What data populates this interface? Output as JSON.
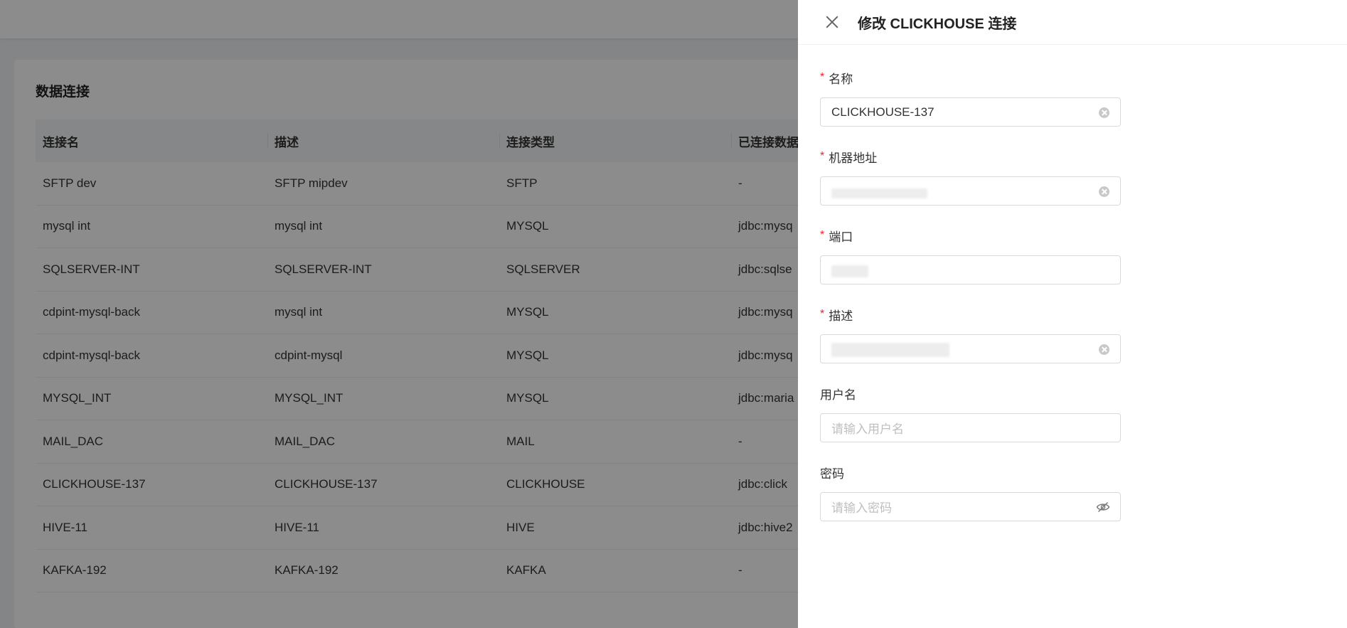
{
  "page": {
    "card_title": "数据连接",
    "table": {
      "headers": [
        "连接名",
        "描述",
        "连接类型",
        "已连接数据"
      ],
      "rows": [
        [
          "SFTP dev",
          "SFTP mipdev",
          "SFTP",
          "-"
        ],
        [
          "mysql int",
          "mysql int",
          "MYSQL",
          "jdbc:mysq"
        ],
        [
          "SQLSERVER-INT",
          "SQLSERVER-INT",
          "SQLSERVER",
          "jdbc:sqlse"
        ],
        [
          "cdpint-mysql-back",
          "mysql int",
          "MYSQL",
          "jdbc:mysq"
        ],
        [
          "cdpint-mysql-back",
          "cdpint-mysql",
          "MYSQL",
          "jdbc:mysq"
        ],
        [
          "MYSQL_INT",
          "MYSQL_INT",
          "MYSQL",
          "jdbc:maria"
        ],
        [
          "MAIL_DAC",
          "MAIL_DAC",
          "MAIL",
          "-"
        ],
        [
          "CLICKHOUSE-137",
          "CLICKHOUSE-137",
          "CLICKHOUSE",
          "jdbc:click"
        ],
        [
          "HIVE-11",
          "HIVE-11",
          "HIVE",
          "jdbc:hive2"
        ],
        [
          "KAFKA-192",
          "KAFKA-192",
          "KAFKA",
          "-"
        ]
      ]
    }
  },
  "drawer": {
    "title": "修改 CLICKHOUSE 连接",
    "required_mark": "*",
    "fields": {
      "name": {
        "label": "名称",
        "value": "CLICKHOUSE-137"
      },
      "host": {
        "label": "机器地址"
      },
      "port": {
        "label": "端口"
      },
      "description": {
        "label": "描述"
      },
      "username": {
        "label": "用户名",
        "placeholder": "请输入用户名"
      },
      "password": {
        "label": "密码",
        "placeholder": "请输入密码"
      }
    }
  },
  "icons": {
    "close": "close-icon",
    "clear": "clear-circle-icon",
    "password_visibility": "eye-off-icon"
  }
}
